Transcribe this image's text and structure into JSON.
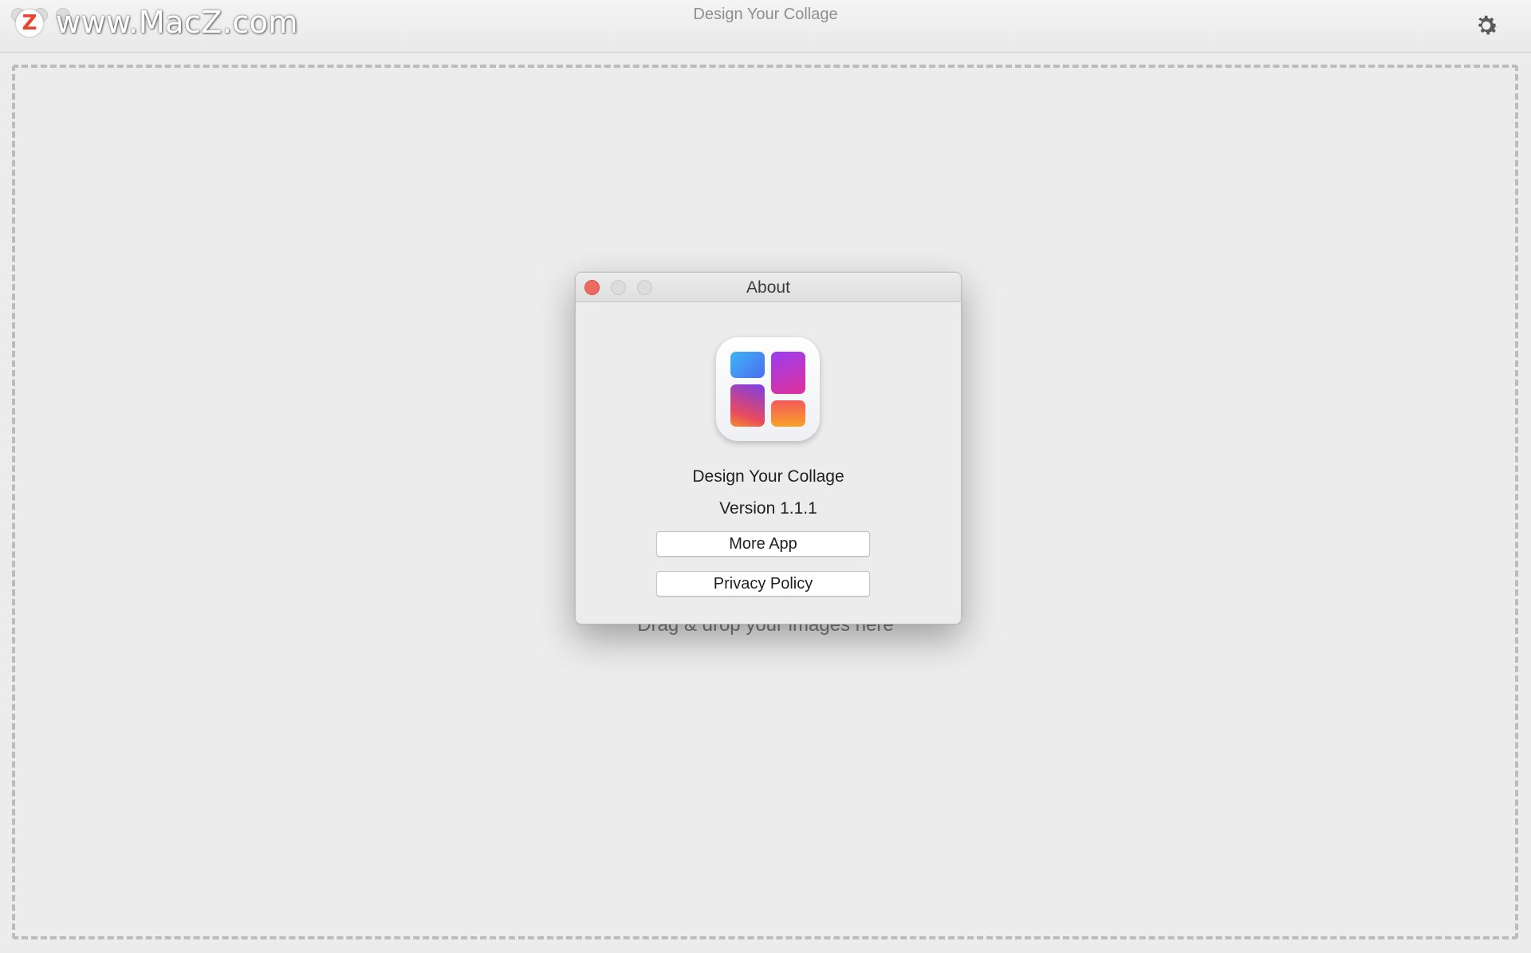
{
  "window": {
    "title": "Design Your Collage",
    "watermark_logo": "Z",
    "watermark_text": "www.MacZ.com",
    "settings_icon": "gear-icon"
  },
  "dropzone": {
    "text": "Drag & drop your images here"
  },
  "about_dialog": {
    "title": "About",
    "app_icon": "collage-app-icon",
    "app_name": "Design Your Collage",
    "version": "Version 1.1.1",
    "buttons": {
      "more_app": "More App",
      "privacy_policy": "Privacy Policy"
    },
    "controls": {
      "close_color": "#ed6a5e",
      "inactive_color": "#dcdcdc"
    }
  }
}
